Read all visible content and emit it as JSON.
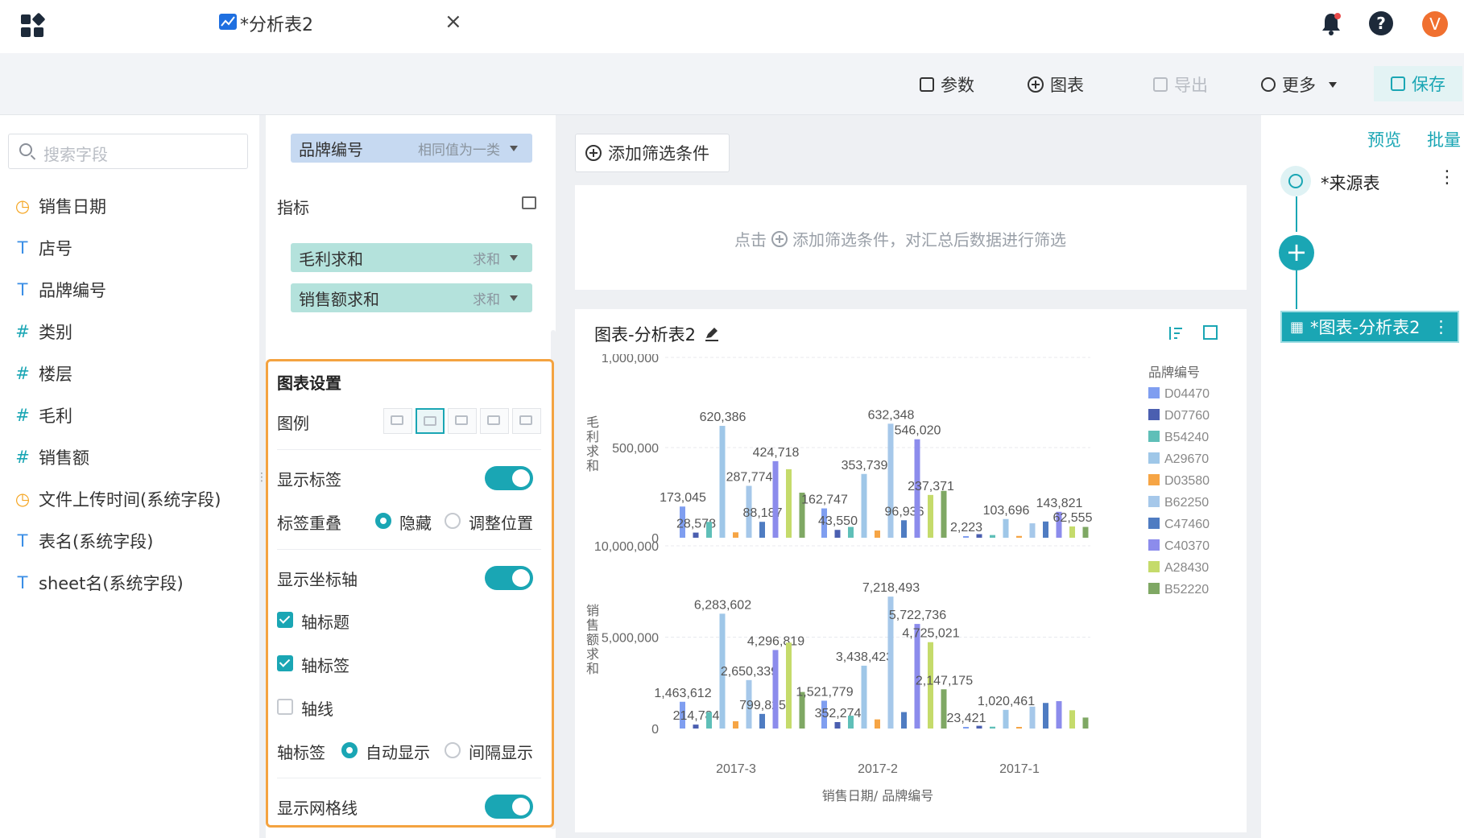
{
  "tab": {
    "title": "*分析表2",
    "close": "×"
  },
  "header": {
    "help": "?",
    "avatar": "V"
  },
  "toolbar": {
    "params": "参数",
    "chart": "图表",
    "export": "导出",
    "more": "更多",
    "save": "保存"
  },
  "fields": {
    "search_placeholder": "搜索字段",
    "items": [
      {
        "label": "销售日期",
        "type": "date",
        "icon": "clock-icon"
      },
      {
        "label": "店号",
        "type": "text",
        "icon": "text-type-icon"
      },
      {
        "label": "品牌编号",
        "type": "text",
        "icon": "text-type-icon"
      },
      {
        "label": "类别",
        "type": "number",
        "icon": "hash-icon"
      },
      {
        "label": "楼层",
        "type": "number",
        "icon": "hash-icon"
      },
      {
        "label": "毛利",
        "type": "number",
        "icon": "hash-icon"
      },
      {
        "label": "销售额",
        "type": "number",
        "icon": "hash-icon"
      },
      {
        "label": "文件上传时间(系统字段)",
        "type": "date",
        "icon": "clock-icon"
      },
      {
        "label": "表名(系统字段)",
        "type": "text",
        "icon": "text-type-icon"
      },
      {
        "label": "sheet名(系统字段)",
        "type": "text",
        "icon": "text-type-icon"
      }
    ]
  },
  "config": {
    "dimension_pill": {
      "label": "品牌编号",
      "sub": "相同值为一类"
    },
    "metrics_title": "指标",
    "metrics": [
      {
        "label": "毛利求和",
        "sub": "求和"
      },
      {
        "label": "销售额求和",
        "sub": "求和"
      }
    ],
    "settings": {
      "title": "图表设置",
      "legend": "图例",
      "show_labels": "显示标签",
      "label_overlap": "标签重叠",
      "overlap_hide": "隐藏",
      "overlap_adjust": "调整位置",
      "show_axis": "显示坐标轴",
      "axis_title": "轴标题",
      "axis_label": "轴标签",
      "axis_line": "轴线",
      "axis_label_mode": "轴标签",
      "auto_show": "自动显示",
      "interval_show": "间隔显示",
      "show_grid": "显示网格线"
    }
  },
  "canvas": {
    "add_filter": "添加筛选条件",
    "filter_hint_prefix": "点击",
    "filter_hint": "添加筛选条件，对汇总后数据进行筛选",
    "chart_title": "图表-分析表2"
  },
  "flow": {
    "preview": "预览",
    "batch": "批量",
    "source": "*来源表",
    "chart_node": "*图表-分析表2"
  },
  "chart_data": {
    "type": "bar",
    "categories": [
      "2017-3",
      "2017-2",
      "2017-1"
    ],
    "legend_title": "品牌编号",
    "series_names": [
      "D04470",
      "D07760",
      "B54240",
      "A29670",
      "D03580",
      "B62250",
      "C47460",
      "C40370",
      "A28430",
      "B52220"
    ],
    "colors": [
      "#7f9ef0",
      "#4b5fb0",
      "#5fbfb8",
      "#9fc7e8",
      "#f6a545",
      "#a6c8ea",
      "#4f7cc2",
      "#8c8cec",
      "#c5db6b",
      "#7fa864"
    ],
    "xlabel": "销售日期/ 品牌编号",
    "panels": [
      {
        "ylabel": "毛利求和",
        "yticks": [
          "1,000,000",
          "500,000",
          "0"
        ],
        "ylim": [
          0,
          1000000
        ],
        "values": [
          [
            173045,
            28578,
            88000,
            620386,
            30000,
            287774,
            88187,
            424718,
            380000,
            250000
          ],
          [
            162747,
            43550,
            60000,
            353739,
            40000,
            632348,
            96936,
            546020,
            237371,
            260000
          ],
          [
            2223,
            20000,
            15000,
            103696,
            10000,
            80000,
            90000,
            143821,
            62555,
            60000
          ]
        ],
        "labels": [
          [
            "173,045",
            "28,578",
            "",
            "620,386",
            "",
            "287,774",
            "88,187",
            "424,718",
            "",
            ""
          ],
          [
            "162,747",
            "43,550",
            "",
            "353,739",
            "",
            "632,348",
            "96,936",
            "546,020",
            "237,371",
            ""
          ],
          [
            "2,223",
            "",
            "",
            "103,696",
            "",
            "",
            "",
            "143,821",
            "62,555",
            ""
          ]
        ]
      },
      {
        "ylabel": "销售额求和",
        "yticks": [
          "10,000,000",
          "5,000,000",
          "0"
        ],
        "ylim": [
          0,
          10000000
        ],
        "values": [
          [
            1463612,
            214784,
            900000,
            6283602,
            400000,
            2650339,
            799825,
            4296819,
            4700000,
            2000000
          ],
          [
            1521779,
            352274,
            700000,
            3438423,
            500000,
            7218493,
            900000,
            5722736,
            4725021,
            2147175
          ],
          [
            23421,
            150000,
            100000,
            1020461,
            80000,
            1200000,
            1400000,
            1500000,
            1000000,
            600000
          ]
        ],
        "labels": [
          [
            "1,463,612",
            "214,784",
            "",
            "6,283,602",
            "",
            "2,650,339",
            "799,825",
            "4,296,819",
            "",
            ""
          ],
          [
            "1,521,779",
            "352,274",
            "",
            "3,438,423",
            "",
            "7,218,493",
            "",
            "5,722,736",
            "4,725,021",
            "2,147,175"
          ],
          [
            "23,421",
            "",
            "",
            "1,020,461",
            "",
            "",
            "",
            "",
            "",
            ""
          ]
        ]
      }
    ]
  }
}
